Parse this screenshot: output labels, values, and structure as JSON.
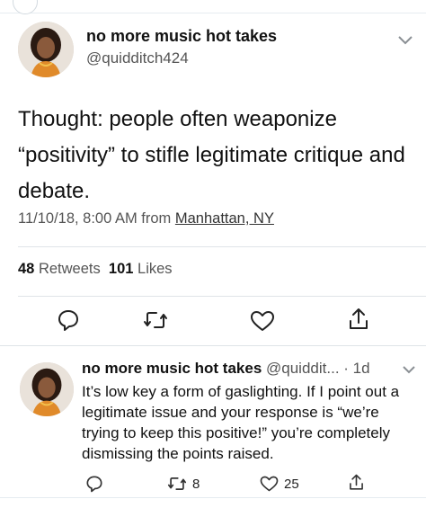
{
  "tweet": {
    "display_name": "no more music hot takes",
    "handle": "@quidditch424",
    "text": "Thought: people often weaponize “positivity” to stifle legitimate critique and debate.",
    "date": "11/10/18, 8:00 AM from ",
    "location": "Manhattan, NY",
    "retweets_count": "48",
    "retweets_label": "Retweets",
    "likes_count": "101",
    "likes_label": "Likes"
  },
  "reply": {
    "display_name": "no more music hot takes",
    "handle": "@quiddit...",
    "age": "· 1d",
    "text": "It’s low key a form of gaslighting. If I point out a legitimate issue and your response is “we’re trying to keep this positive!” you’re completely dismissing the points raised.",
    "retweet_count": "8",
    "like_count": "25"
  },
  "icons": {
    "reply": "reply-icon",
    "retweet": "retweet-icon",
    "like": "heart-icon",
    "share": "share-icon",
    "caret": "chevron-down-icon"
  },
  "colors": {
    "text": "#111111",
    "secondary": "#555555",
    "divider": "#dfe4e8"
  }
}
